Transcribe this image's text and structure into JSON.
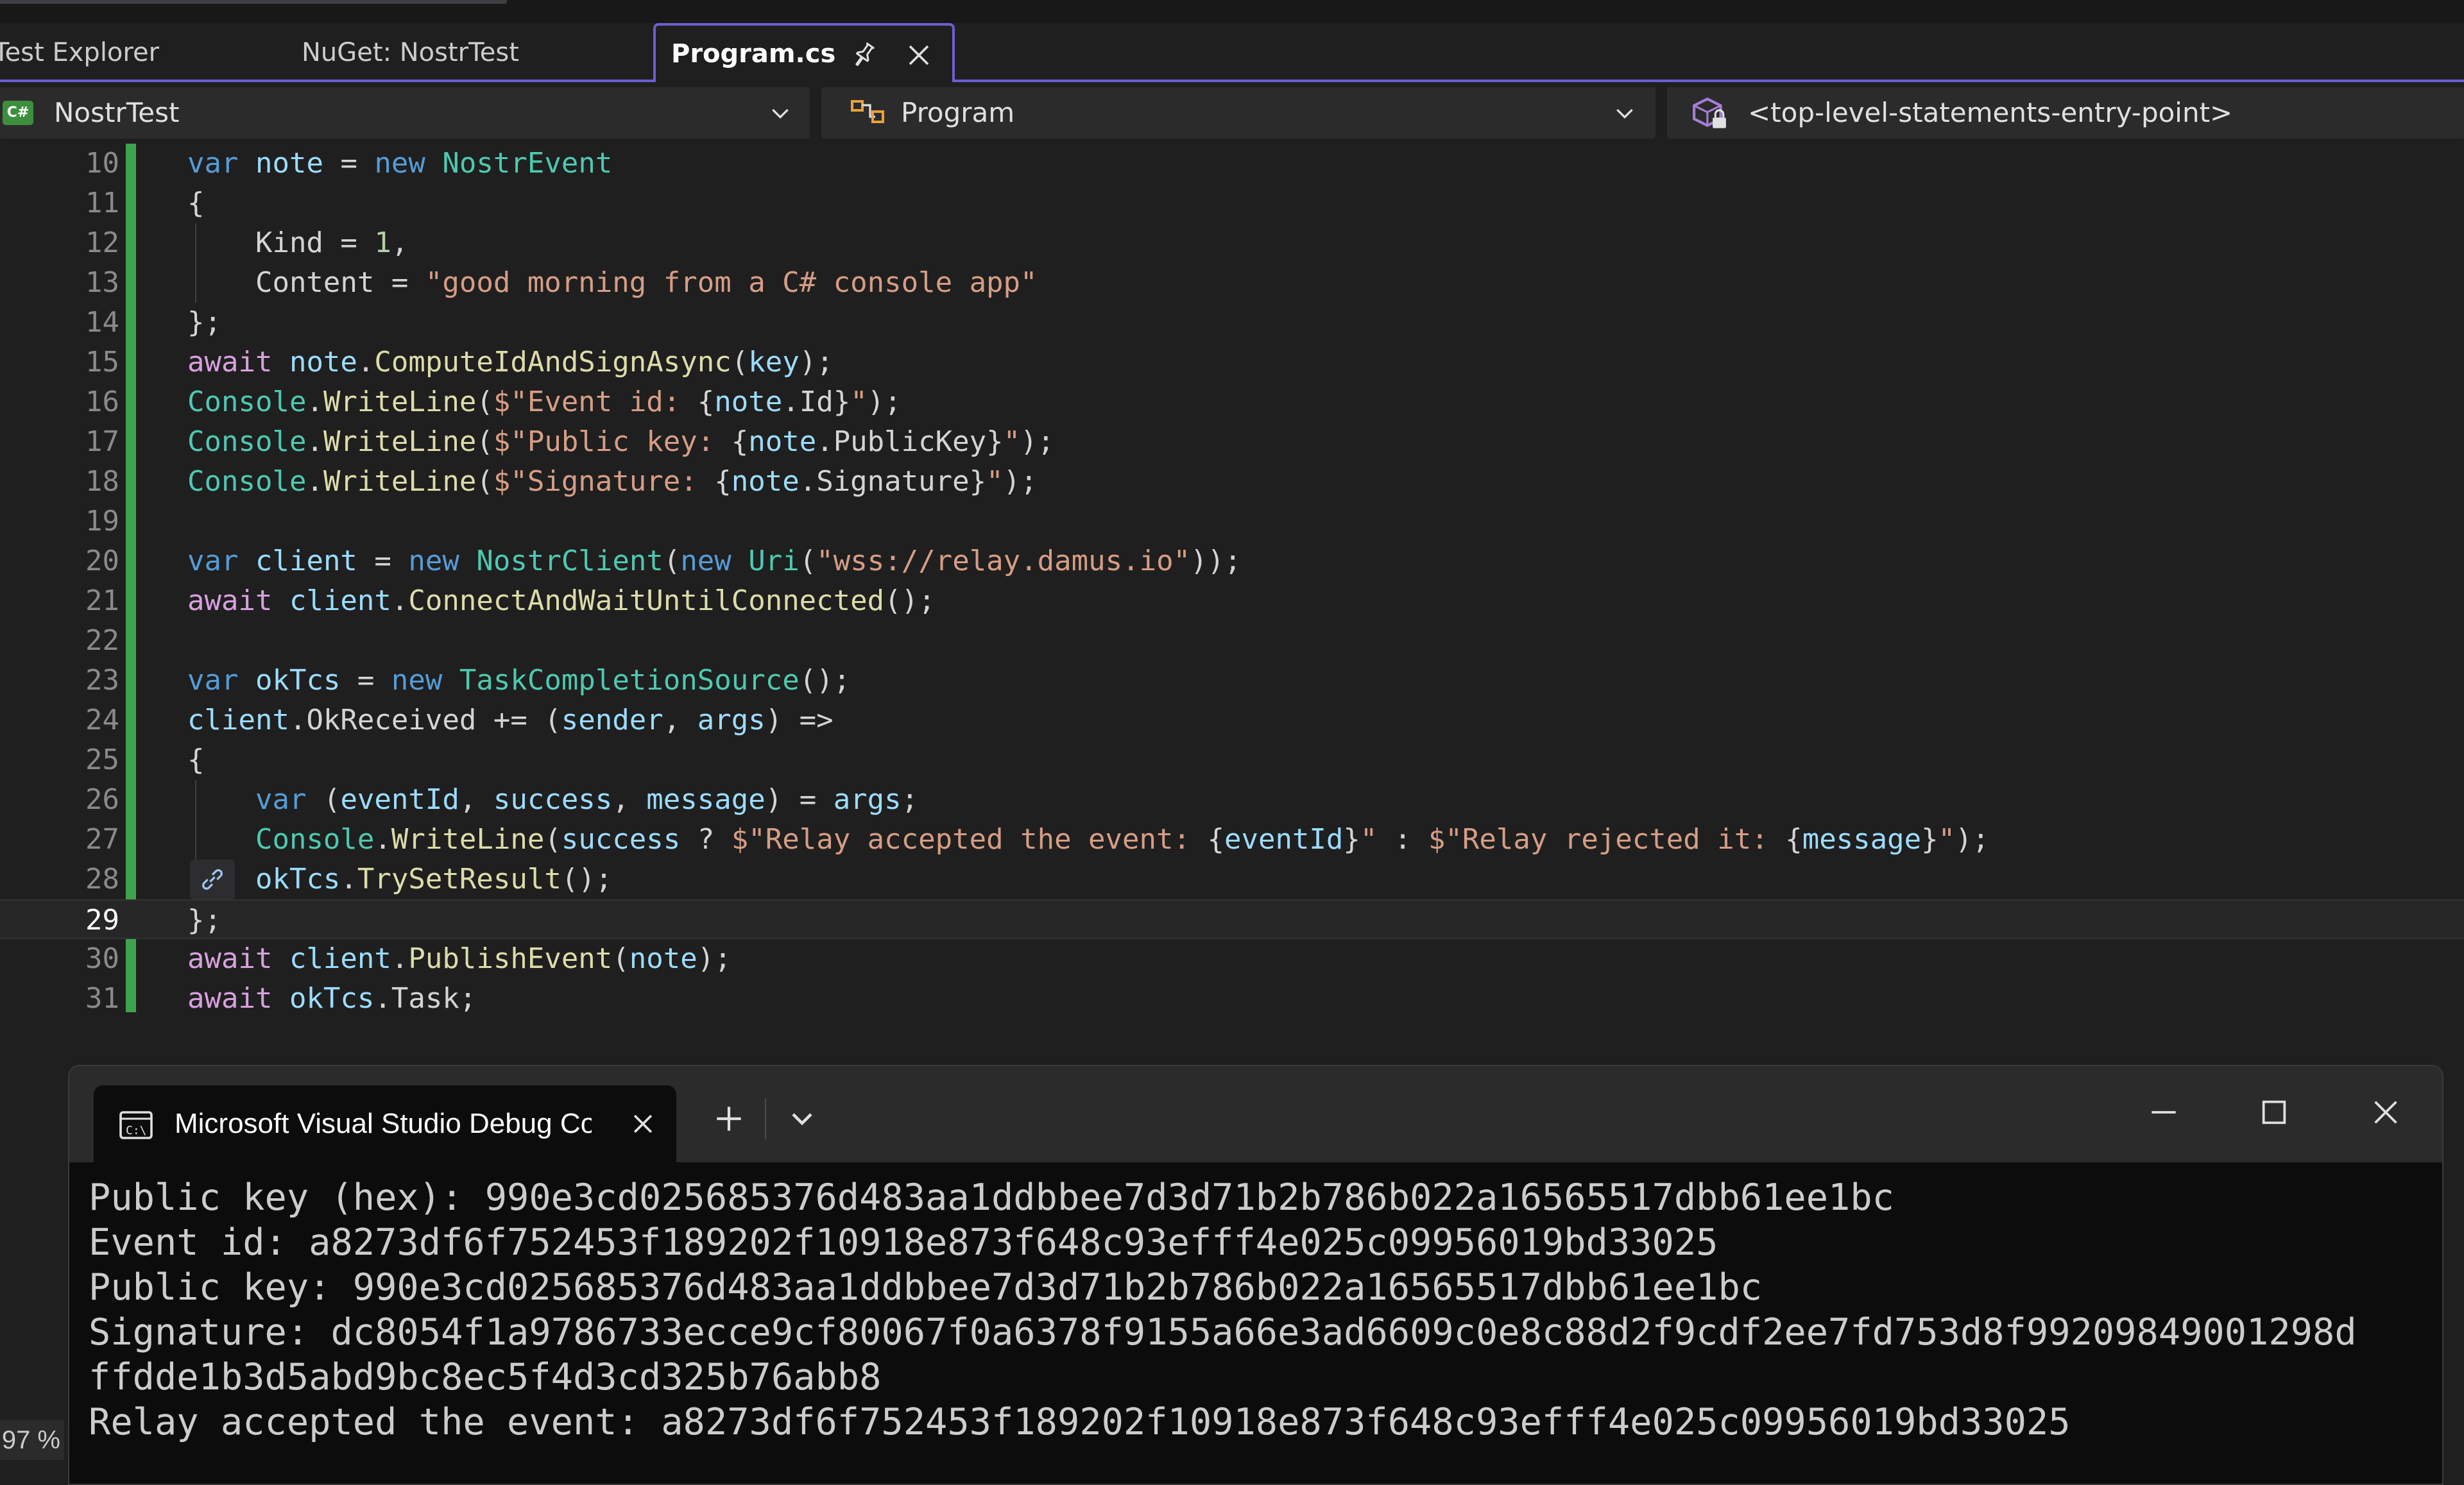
{
  "tabs": [
    {
      "label": "Test Explorer",
      "active": false
    },
    {
      "label": "NuGet: NostrTest",
      "active": false
    },
    {
      "label": "Program.cs",
      "active": true
    }
  ],
  "navbar": {
    "project": "NostrTest",
    "project_badge": "C#",
    "type": "Program",
    "member": "<top-level-statements-entry-point>"
  },
  "editor": {
    "current_line": 29,
    "lines": [
      {
        "num": 10,
        "tokens": [
          [
            "kw",
            "var"
          ],
          [
            "",
            " "
          ],
          [
            "vr",
            "note"
          ],
          [
            "",
            " = "
          ],
          [
            "kw",
            "new"
          ],
          [
            "",
            " "
          ],
          [
            "type",
            "NostrEvent"
          ]
        ]
      },
      {
        "num": 11,
        "tokens": [
          [
            "",
            "{"
          ]
        ]
      },
      {
        "num": 12,
        "tokens": [
          [
            "",
            "    Kind = "
          ],
          [
            "num",
            "1"
          ],
          [
            "",
            ","
          ]
        ]
      },
      {
        "num": 13,
        "tokens": [
          [
            "",
            "    Content = "
          ],
          [
            "str",
            "\"good morning from a C# console app\""
          ]
        ]
      },
      {
        "num": 14,
        "tokens": [
          [
            "",
            "};"
          ]
        ]
      },
      {
        "num": 15,
        "tokens": [
          [
            "ctl",
            "await"
          ],
          [
            "",
            " "
          ],
          [
            "vr",
            "note"
          ],
          [
            "",
            "."
          ],
          [
            "fn",
            "ComputeIdAndSignAsync"
          ],
          [
            "",
            "("
          ],
          [
            "vr",
            "key"
          ],
          [
            "",
            ");"
          ]
        ]
      },
      {
        "num": 16,
        "tokens": [
          [
            "type",
            "Console"
          ],
          [
            "",
            "."
          ],
          [
            "fn",
            "WriteLine"
          ],
          [
            "",
            "("
          ],
          [
            "str",
            "$\"Event id: "
          ],
          [
            "",
            "{"
          ],
          [
            "vr",
            "note"
          ],
          [
            "",
            ".Id}"
          ],
          [
            "str",
            "\""
          ],
          [
            "",
            ");"
          ]
        ]
      },
      {
        "num": 17,
        "tokens": [
          [
            "type",
            "Console"
          ],
          [
            "",
            "."
          ],
          [
            "fn",
            "WriteLine"
          ],
          [
            "",
            "("
          ],
          [
            "str",
            "$\"Public key: "
          ],
          [
            "",
            "{"
          ],
          [
            "vr",
            "note"
          ],
          [
            "",
            ".PublicKey}"
          ],
          [
            "str",
            "\""
          ],
          [
            "",
            ");"
          ]
        ]
      },
      {
        "num": 18,
        "tokens": [
          [
            "type",
            "Console"
          ],
          [
            "",
            "."
          ],
          [
            "fn",
            "WriteLine"
          ],
          [
            "",
            "("
          ],
          [
            "str",
            "$\"Signature: "
          ],
          [
            "",
            "{"
          ],
          [
            "vr",
            "note"
          ],
          [
            "",
            ".Signature}"
          ],
          [
            "str",
            "\""
          ],
          [
            "",
            ");"
          ]
        ]
      },
      {
        "num": 19,
        "tokens": []
      },
      {
        "num": 20,
        "tokens": [
          [
            "kw",
            "var"
          ],
          [
            "",
            " "
          ],
          [
            "vr",
            "client"
          ],
          [
            "",
            " = "
          ],
          [
            "kw",
            "new"
          ],
          [
            "",
            " "
          ],
          [
            "type",
            "NostrClient"
          ],
          [
            "",
            "("
          ],
          [
            "kw",
            "new"
          ],
          [
            "",
            " "
          ],
          [
            "type",
            "Uri"
          ],
          [
            "",
            "("
          ],
          [
            "str",
            "\"wss://relay.damus.io\""
          ],
          [
            "",
            "));"
          ]
        ]
      },
      {
        "num": 21,
        "tokens": [
          [
            "ctl",
            "await"
          ],
          [
            "",
            " "
          ],
          [
            "vr",
            "client"
          ],
          [
            "",
            "."
          ],
          [
            "fn",
            "ConnectAndWaitUntilConnected"
          ],
          [
            "",
            "();"
          ]
        ]
      },
      {
        "num": 22,
        "tokens": []
      },
      {
        "num": 23,
        "tokens": [
          [
            "kw",
            "var"
          ],
          [
            "",
            " "
          ],
          [
            "vr",
            "okTcs"
          ],
          [
            "",
            " = "
          ],
          [
            "kw",
            "new"
          ],
          [
            "",
            " "
          ],
          [
            "type",
            "TaskCompletionSource"
          ],
          [
            "",
            "();"
          ]
        ]
      },
      {
        "num": 24,
        "tokens": [
          [
            "vr",
            "client"
          ],
          [
            "",
            ".OkReceived += ("
          ],
          [
            "vr",
            "sender"
          ],
          [
            "",
            ", "
          ],
          [
            "vr",
            "args"
          ],
          [
            "",
            ") =>"
          ]
        ]
      },
      {
        "num": 25,
        "tokens": [
          [
            "",
            "{"
          ]
        ]
      },
      {
        "num": 26,
        "tokens": [
          [
            "",
            "    "
          ],
          [
            "kw",
            "var"
          ],
          [
            "",
            " ("
          ],
          [
            "vr",
            "eventId"
          ],
          [
            "",
            ", "
          ],
          [
            "vr",
            "success"
          ],
          [
            "",
            ", "
          ],
          [
            "vr",
            "message"
          ],
          [
            "",
            ") = "
          ],
          [
            "vr",
            "args"
          ],
          [
            "",
            ";"
          ]
        ]
      },
      {
        "num": 27,
        "tokens": [
          [
            "",
            "    "
          ],
          [
            "type",
            "Console"
          ],
          [
            "",
            "."
          ],
          [
            "fn",
            "WriteLine"
          ],
          [
            "",
            "("
          ],
          [
            "vr",
            "success"
          ],
          [
            "",
            " ? "
          ],
          [
            "str",
            "$\"Relay accepted the event: "
          ],
          [
            "",
            "{"
          ],
          [
            "vr",
            "eventId"
          ],
          [
            "",
            "}"
          ],
          [
            "str",
            "\""
          ],
          [
            "",
            " : "
          ],
          [
            "str",
            "$\"Relay rejected it: "
          ],
          [
            "",
            "{"
          ],
          [
            "vr",
            "message"
          ],
          [
            "",
            "}"
          ],
          [
            "str",
            "\""
          ],
          [
            "",
            ");"
          ]
        ]
      },
      {
        "num": 28,
        "tokens": [
          [
            "",
            "    "
          ],
          [
            "vr",
            "okTcs"
          ],
          [
            "",
            "."
          ],
          [
            "fn",
            "TrySetResult"
          ],
          [
            "",
            "();"
          ]
        ]
      },
      {
        "num": 29,
        "tokens": [
          [
            "",
            "};"
          ]
        ]
      },
      {
        "num": 30,
        "tokens": [
          [
            "ctl",
            "await"
          ],
          [
            "",
            " "
          ],
          [
            "vr",
            "client"
          ],
          [
            "",
            "."
          ],
          [
            "fn",
            "PublishEvent"
          ],
          [
            "",
            "("
          ],
          [
            "vr",
            "note"
          ],
          [
            "",
            ");"
          ]
        ]
      },
      {
        "num": 31,
        "tokens": [
          [
            "ctl",
            "await"
          ],
          [
            "",
            " "
          ],
          [
            "vr",
            "okTcs"
          ],
          [
            "",
            ".Task;"
          ]
        ]
      }
    ]
  },
  "terminal": {
    "tab_title": "Microsoft Visual Studio Debug Console",
    "output": [
      "Public key (hex): 990e3cd025685376d483aa1ddbbee7d3d71b2b786b022a16565517dbb61ee1bc",
      "Event id: a8273df6f752453f189202f10918e873f648c93efff4e025c09956019bd33025",
      "Public key: 990e3cd025685376d483aa1ddbbee7d3d71b2b786b022a16565517dbb61ee1bc",
      "Signature: dc8054f1a9786733ecce9cf80067f0a6378f9155a66e3ad6609c0e8c88d2f9cdf2ee7fd753d8f99209849001298d",
      "ffdde1b3d5abd9bc8ec5f4d3cd325b76abb8",
      "Relay accepted the event: a8273df6f752453f189202f10918e873f648c93efff4e025c09956019bd33025"
    ]
  },
  "status": {
    "zoom": "97 %"
  },
  "colors": {
    "accent": "#6c5fd1",
    "change_bar": "#3fa34d"
  }
}
